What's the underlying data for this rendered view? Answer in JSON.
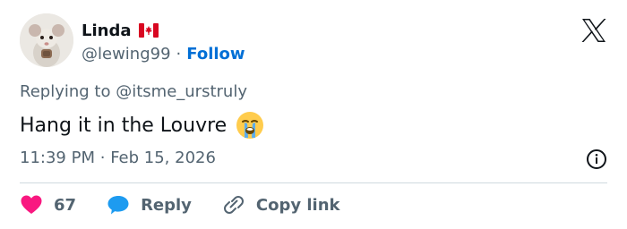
{
  "user": {
    "name": "Linda",
    "handle": "@lewing99",
    "separator": "·",
    "follow_label": "Follow"
  },
  "reply": {
    "prefix": "Replying to",
    "mention": "@itsme_urstruly"
  },
  "tweet": {
    "text": "Hang it in the Louvre"
  },
  "meta": {
    "time": "11:39 PM",
    "separator": "·",
    "date": "Feb 15, 2026"
  },
  "actions": {
    "likes": "67",
    "reply_label": "Reply",
    "copy_label": "Copy link"
  },
  "colors": {
    "accent": "#006fd6",
    "like": "#f91880",
    "reply_icon": "#1d9bf0",
    "muted": "#536471"
  },
  "icons": [
    "avatar-rat-photo",
    "canada-flag-icon",
    "x-logo-icon",
    "crying-face-emoji",
    "info-icon",
    "heart-icon",
    "reply-bubble-icon",
    "link-icon"
  ]
}
